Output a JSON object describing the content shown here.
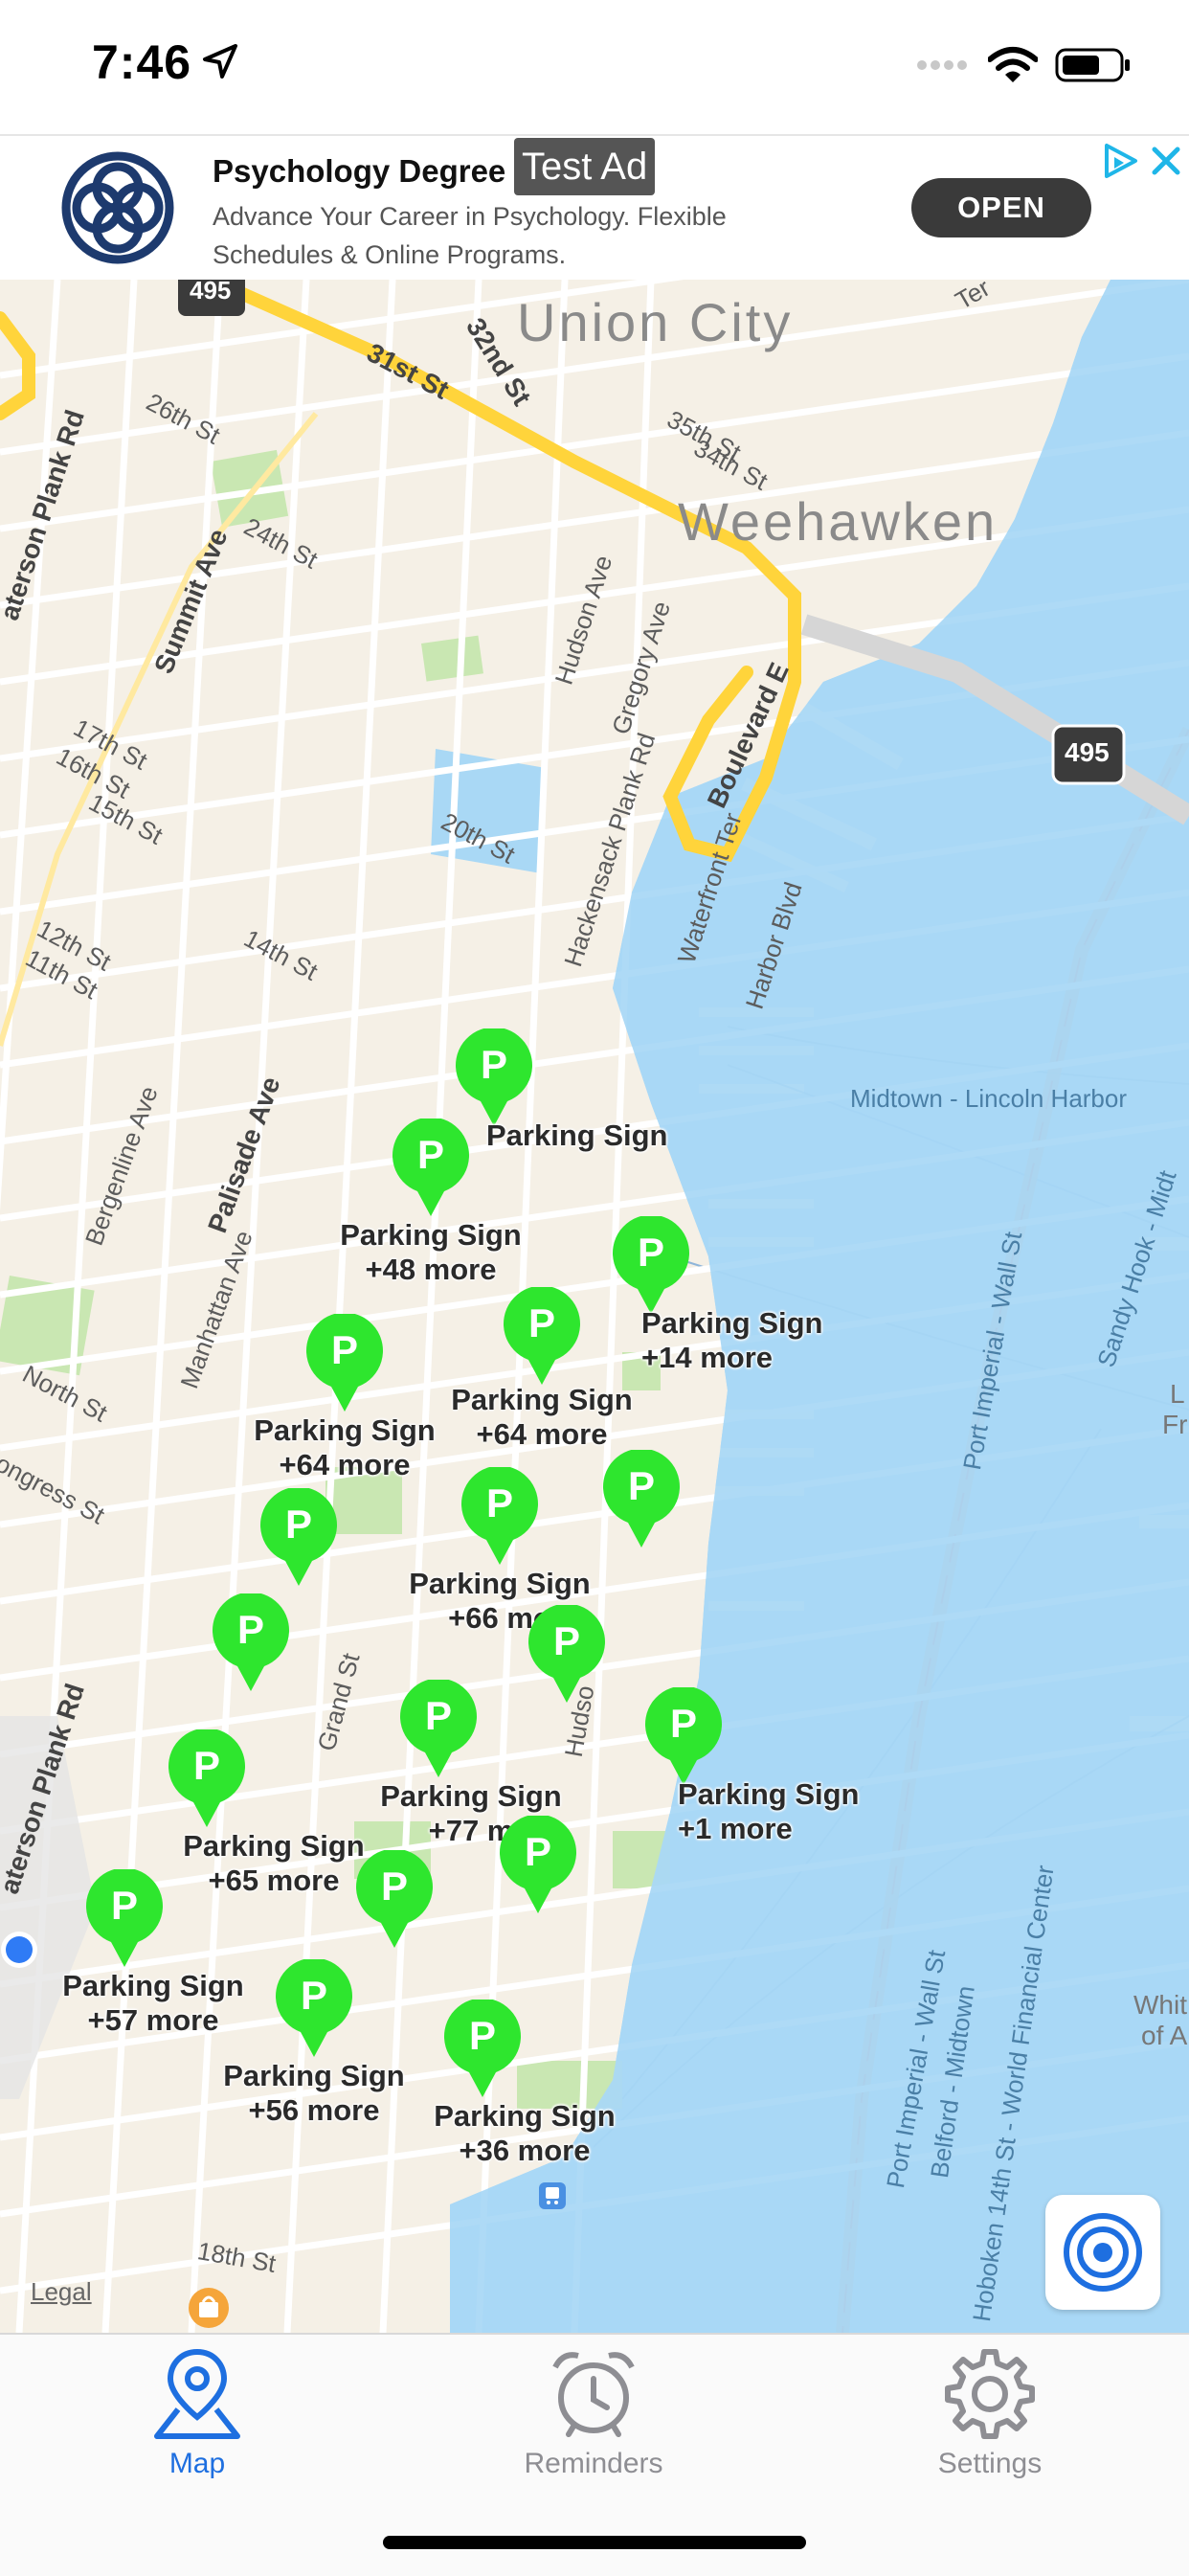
{
  "status_bar": {
    "time": "7:46",
    "icons": [
      "location-arrow-icon",
      "signal-dots-icon",
      "wifi-icon",
      "battery-icon"
    ]
  },
  "ad": {
    "title": "Psychology Degree",
    "tag": "Test Ad",
    "description": "Advance Your Career in Psychology. Flexible Schedules & Online Programs.",
    "cta": "OPEN",
    "icons": [
      "celtic-knot-logo-icon",
      "ad-choices-icon",
      "close-icon"
    ]
  },
  "map": {
    "places": {
      "union_city": "Union City",
      "weehawken": "Weehawken"
    },
    "streets": {
      "s_31st": "31st St",
      "s_32nd": "32nd St",
      "s_26th": "26th St",
      "s_24th": "24th St",
      "s_35th": "35th St",
      "s_34th": "34th St",
      "s_17th": "17th St",
      "s_16th": "16th St",
      "s_15th": "15th St",
      "s_12th": "12th St",
      "s_11th": "11th St",
      "s_14th": "14th St",
      "s_20th": "20th St",
      "s_18th": "18th St",
      "summit": "Summit Ave",
      "paterson": "aterson Plank Rd",
      "paterson2": "aterson Plank Rd",
      "hudson": "Hudson Ave",
      "gregory": "Gregory Ave",
      "boulevard_e": "Boulevard E",
      "hackensack": "Hackensack Plank Rd",
      "waterfront": "Waterfront Ter",
      "harbor": "Harbor Blvd",
      "palisade": "Palisade Ave",
      "bergenline": "Bergenline Ave",
      "manhattan": "Manhattan Ave",
      "north": "North St",
      "congress": "ongress St",
      "grand": "Grand St",
      "hudson_st": "Hudso",
      "ter": "Ter"
    },
    "water_labels": {
      "midtown_lincoln": "Midtown - Lincoln Harbor",
      "port_imperial_wall": "Port Imperial - Wall St",
      "sandy_hook": "Sandy Hook - Midt",
      "port_imperial_wall2": "Port Imperial - Wall St",
      "belford": "Belford - Midtown",
      "hoboken": "Hoboken 14th St - World Financial Center"
    },
    "highway_shields": [
      "495",
      "495"
    ],
    "edge_labels": {
      "l": "L",
      "fr": "Fr",
      "whit": "Whit",
      "of_a": "of A"
    },
    "markers": [
      {
        "letter": "P",
        "title": "Parking Sign",
        "more": ""
      },
      {
        "letter": "P",
        "title": "Parking Sign",
        "more": "+48 more"
      },
      {
        "letter": "P",
        "title": "Parking Sign",
        "more": "+14 more"
      },
      {
        "letter": "P",
        "title": "",
        "more": ""
      },
      {
        "letter": "P",
        "title": "Parking Sign",
        "more": "+64 more"
      },
      {
        "letter": "P",
        "title": "Parking Sign",
        "more": "+64 more"
      },
      {
        "letter": "P",
        "title": "",
        "more": ""
      },
      {
        "letter": "P",
        "title": "",
        "more": ""
      },
      {
        "letter": "P",
        "title": "Parking Sign",
        "more": "+66 mo"
      },
      {
        "letter": "P",
        "title": "",
        "more": ""
      },
      {
        "letter": "P",
        "title": "",
        "more": ""
      },
      {
        "letter": "P",
        "title": "Parking Sign",
        "more": "+77 m"
      },
      {
        "letter": "P",
        "title": "Parking Sign",
        "more": "+1 more"
      },
      {
        "letter": "P",
        "title": "Parking Sign",
        "more": "+65 more"
      },
      {
        "letter": "P",
        "title": "",
        "more": ""
      },
      {
        "letter": "P",
        "title": "",
        "more": ""
      },
      {
        "letter": "P",
        "title": "Parking Sign",
        "more": "+57 more"
      },
      {
        "letter": "P",
        "title": "Parking Sign",
        "more": "+56 more"
      },
      {
        "letter": "P",
        "title": "Parking Sign",
        "more": "+36 more"
      }
    ],
    "legal": "Legal",
    "colors": {
      "land": "#f5f0e6",
      "water": "#a9d8f5",
      "road": "#ffffff",
      "highway": "#ffd43b",
      "park": "#c9e7b2",
      "marker": "#2ee62e",
      "accent": "#1e6fe0"
    }
  },
  "tabs": [
    {
      "label": "Map",
      "icon": "map-pin-icon",
      "active": true
    },
    {
      "label": "Reminders",
      "icon": "alarm-clock-icon",
      "active": false
    },
    {
      "label": "Settings",
      "icon": "gear-icon",
      "active": false
    }
  ]
}
